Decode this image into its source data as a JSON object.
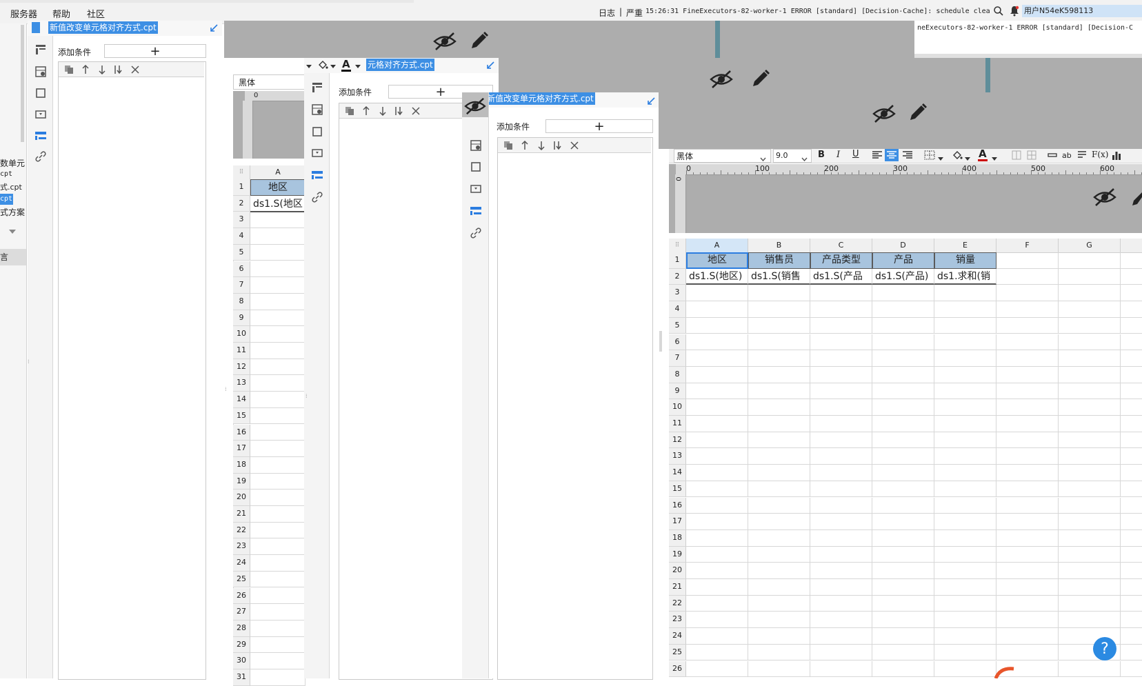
{
  "menubar": {
    "items": [
      "服务器",
      "帮助",
      "社区"
    ],
    "log_label": "日志",
    "severity_label": "严重",
    "log_message": "15:26:31 FineExecutors-82-worker-1 ERROR [standard] [Decision-Cache]: schedule clean ...",
    "user_label": "用户N54eK598113",
    "log_message_2": "neExecutors-82-worker-1 ERROR [standard] [Decision-C"
  },
  "left_tree": {
    "items": [
      "数单元",
      "cpt",
      "式.cpt",
      "cpt",
      "式方案"
    ],
    "bottom_item": "言"
  },
  "panel1": {
    "title": "新值改变单元格对齐方式.cpt",
    "add_condition_label": "添加条件",
    "add_button": "+",
    "font_name": "黑体",
    "ruler_zero": "0"
  },
  "panel2": {
    "title": "元格对齐方式.cpt",
    "add_condition_label": "添加条件",
    "add_button": "+",
    "font_color_letter": "A"
  },
  "panel3": {
    "title": "新值改变单元格对齐方式.cpt",
    "add_condition_label": "添加条件",
    "add_button": "+"
  },
  "sheet_small": {
    "column": "A",
    "header_cell": "地区",
    "data_cell": "ds1.S(地区",
    "row_numbers": [
      "1",
      "2",
      "3",
      "4",
      "5",
      "6",
      "7",
      "8",
      "9",
      "10",
      "11",
      "12",
      "13",
      "14",
      "15",
      "16",
      "17",
      "18",
      "19",
      "20",
      "21",
      "22",
      "23",
      "24",
      "25",
      "26",
      "27",
      "28",
      "29",
      "30",
      "31"
    ]
  },
  "sheet_main": {
    "font_name": "黑体",
    "font_size": "9.0",
    "bold": "B",
    "italic": "I",
    "underline": "U",
    "font_color_letter": "A",
    "ab_label": "ab",
    "fx_label": "F(x)",
    "ruler_ticks": [
      "0",
      "100",
      "200",
      "300",
      "400",
      "500",
      "600"
    ],
    "vruler_zero": "0",
    "columns": [
      "A",
      "B",
      "C",
      "D",
      "E",
      "F",
      "G"
    ],
    "header_row": [
      "地区",
      "销售员",
      "产品类型",
      "产品",
      "销量"
    ],
    "data_row": [
      "ds1.S(地区)",
      "ds1.S(销售",
      "ds1.S(产品",
      "ds1.S(产品)",
      "ds1.求和(销"
    ],
    "row_numbers": [
      "1",
      "2",
      "3",
      "4",
      "5",
      "6",
      "7",
      "8",
      "9",
      "10",
      "11",
      "12",
      "13",
      "14",
      "15",
      "16",
      "17",
      "18",
      "19",
      "20",
      "21",
      "22",
      "23",
      "24",
      "25",
      "26"
    ]
  },
  "help_button": "?",
  "colors": {
    "selection": "#3d8fe4",
    "header_cell": "#a8c4de",
    "gray_overlay": "#adadad",
    "help_button": "#2b8ae2",
    "teal_divider": "#5f8e9a"
  }
}
